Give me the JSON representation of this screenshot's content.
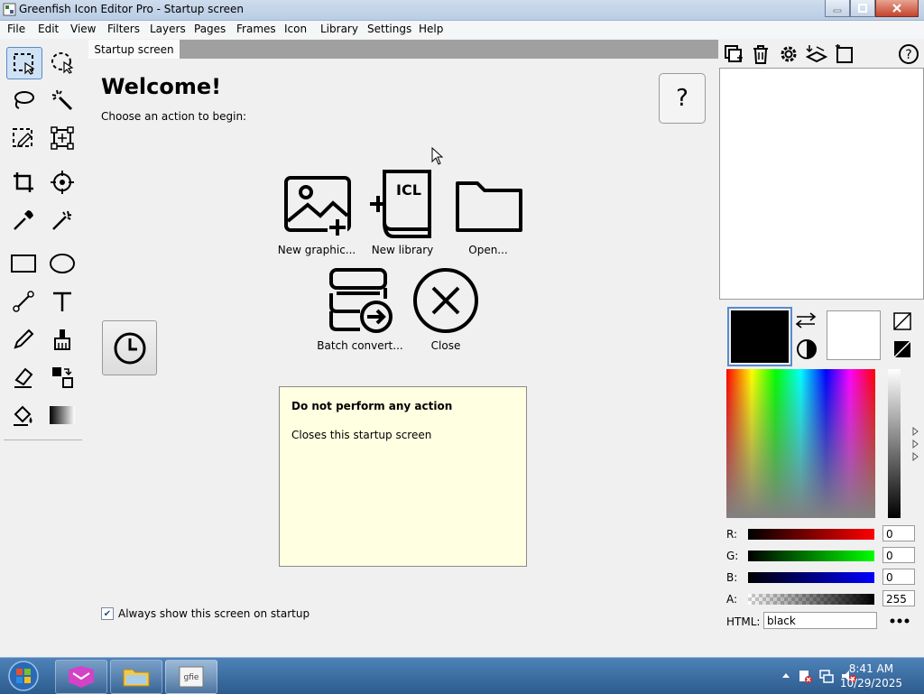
{
  "window": {
    "title": "Greenfish Icon Editor Pro - Startup screen"
  },
  "menu": [
    "File",
    "Edit",
    "View",
    "Filters",
    "Layers",
    "Pages",
    "Frames",
    "Icon",
    "Library",
    "Settings",
    "Help"
  ],
  "tabs": [
    {
      "label": "Startup screen"
    }
  ],
  "startup": {
    "heading": "Welcome!",
    "subtitle": "Choose an action to begin:",
    "help_symbol": "?",
    "actions": [
      {
        "label": "New graphic...",
        "icon": "new-graphic-icon"
      },
      {
        "label": "New library",
        "icon": "new-library-icon",
        "icon_text": "ICL"
      },
      {
        "label": "Open...",
        "icon": "folder-icon"
      },
      {
        "label": "Batch convert...",
        "icon": "batch-convert-icon"
      },
      {
        "label": "Close",
        "icon": "close-circle-icon"
      }
    ],
    "info": {
      "title": "Do not perform any action",
      "text": "Closes this startup screen"
    },
    "always_show": {
      "label": "Always show this screen on startup",
      "checked": true
    }
  },
  "color": {
    "primary": "#000000",
    "secondary": "#ffffff",
    "channels": [
      {
        "label": "R:",
        "value": "0",
        "color": "#ff0000"
      },
      {
        "label": "G:",
        "value": "0",
        "color": "#00ff00"
      },
      {
        "label": "B:",
        "value": "0",
        "color": "#0000ff"
      },
      {
        "label": "A:",
        "value": "255",
        "color": "#000000"
      }
    ],
    "html_label": "HTML:",
    "html_value": "black"
  },
  "taskbar": {
    "time": "8:41 AM",
    "date": "10/29/2025"
  },
  "tools": [
    "rect-select-icon",
    "ellipse-select-icon",
    "lasso-icon",
    "magic-wand-icon",
    "pen-select-icon",
    "transform-icon",
    "crop-icon",
    "hotspot-icon",
    "color-picker-icon",
    "retouch-icon",
    "rectangle-icon",
    "ellipse-icon",
    "line-icon",
    "text-icon",
    "pencil-icon",
    "brush-icon",
    "eraser-icon",
    "replace-color-icon",
    "fill-icon",
    "gradient-icon"
  ]
}
